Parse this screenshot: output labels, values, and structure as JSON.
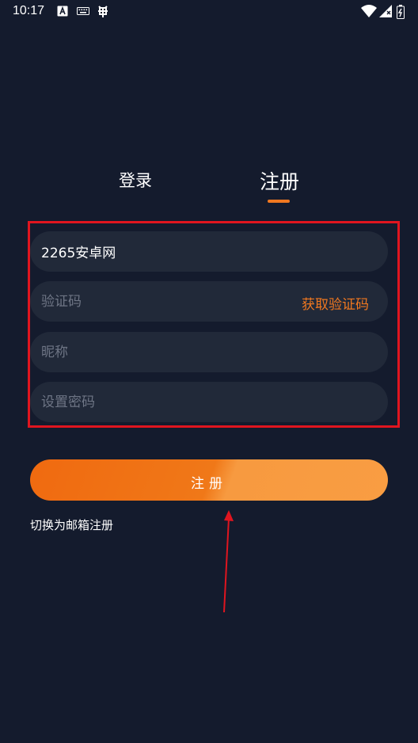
{
  "status_bar": {
    "time": "10:17",
    "icons": [
      "a-app-icon",
      "keyboard-icon",
      "bug-icon",
      "wifi-icon",
      "signal-icon",
      "battery-icon"
    ]
  },
  "tabs": [
    {
      "label": "登录",
      "active": false
    },
    {
      "label": "注册",
      "active": true
    }
  ],
  "form": {
    "phone_value": "2265安卓网",
    "code_placeholder": "验证码",
    "get_code_label": "获取验证码",
    "nickname_placeholder": "昵称",
    "password_placeholder": "设置密码"
  },
  "submit": {
    "label": "注册"
  },
  "switch_link": "切换为邮箱注册",
  "colors": {
    "background": "#141b2d",
    "field": "#212939",
    "accent": "#f07820",
    "highlight_box": "#e0151f"
  }
}
